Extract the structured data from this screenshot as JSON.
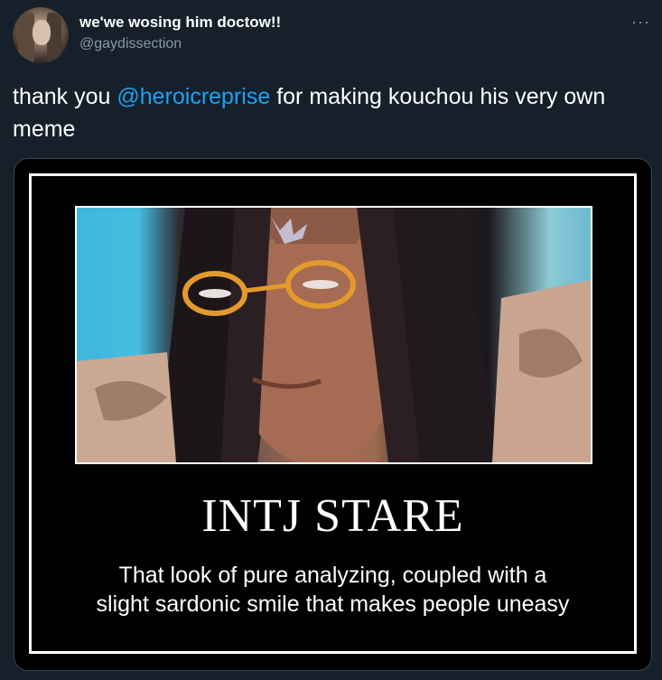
{
  "tweet": {
    "author": {
      "display_name": "we'we wosing him doctow!!",
      "handle": "@gaydissection"
    },
    "more_icon": "ellipsis-icon",
    "text_before": "thank you ",
    "mention": "@heroicreprise",
    "text_after": " for making kouchou his very own meme"
  },
  "meme": {
    "title": "INTJ STARE",
    "caption_line1": "That look of pure analyzing, coupled with a",
    "caption_line2": "slight sardonic smile that makes people uneasy"
  },
  "colors": {
    "background": "#15202b",
    "link": "#1da1f2",
    "secondary_text": "#8899a6"
  }
}
